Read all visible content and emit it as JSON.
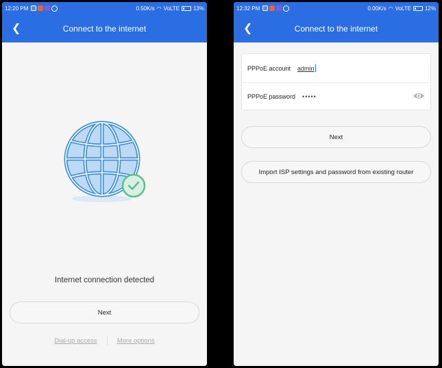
{
  "left": {
    "status": {
      "time": "12:20 PM",
      "speed": "0.50K/s",
      "network": "VoLTE",
      "battery": "13%"
    },
    "title": "Connect to the internet",
    "message": "Internet connection detected",
    "next_label": "Next",
    "dialup_label": "Dial-up access",
    "more_label": "More options"
  },
  "right": {
    "status": {
      "time": "12:32 PM",
      "speed": "0.00K/s",
      "network": "VoLTE",
      "battery": "12%"
    },
    "title": "Connect to the internet",
    "account_label": "PPPoE account",
    "account_value": "admin",
    "password_label": "PPPoE password",
    "password_value": "•••••",
    "next_label": "Next",
    "import_label": "Import ISP settings and password from existing router"
  },
  "colors": {
    "accent": "#2b6de3",
    "globe": "#3e8fd6",
    "check": "#5cc08a"
  },
  "icons": [
    "back-icon",
    "globe-icon",
    "check-icon",
    "eye-icon",
    "wifi-icon",
    "battery-icon"
  ]
}
